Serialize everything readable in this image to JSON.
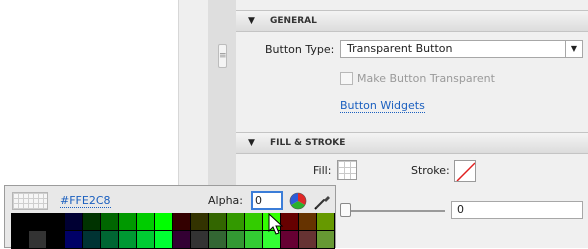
{
  "general": {
    "header": "GENERAL",
    "button_type_label": "Button Type:",
    "button_type_value": "Transparent Button",
    "make_transparent_label": "Make Button Transparent",
    "make_transparent_checked": false,
    "widgets_link": "Button Widgets"
  },
  "fill_stroke": {
    "header": "FILL & STROKE",
    "fill_label": "Fill:",
    "stroke_label": "Stroke:",
    "alpha_value": "0"
  },
  "color_picker": {
    "hex": "#FFE2C8",
    "alpha_label": "Alpha:",
    "alpha_value": "0",
    "wheel_icon": "color-wheel-icon",
    "dropper_icon": "eyedropper-icon",
    "swatch_rows": [
      [
        "#000000",
        "#000000",
        "#000000",
        "#000033",
        "#003300",
        "#006600",
        "#009900",
        "#00cc00",
        "#00ff00",
        "#330000",
        "#333300",
        "#336600",
        "#339900",
        "#33cc00",
        "#33ff00",
        "#660000",
        "#663300",
        "#669900"
      ],
      [
        "#000000",
        "#333333",
        "#000000",
        "#000066",
        "#003333",
        "#006633",
        "#009933",
        "#00cc33",
        "#00ff33",
        "#330033",
        "#333333",
        "#336633",
        "#339933",
        "#33cc33",
        "#33ff33",
        "#660033",
        "#663333",
        "#669933"
      ]
    ]
  }
}
